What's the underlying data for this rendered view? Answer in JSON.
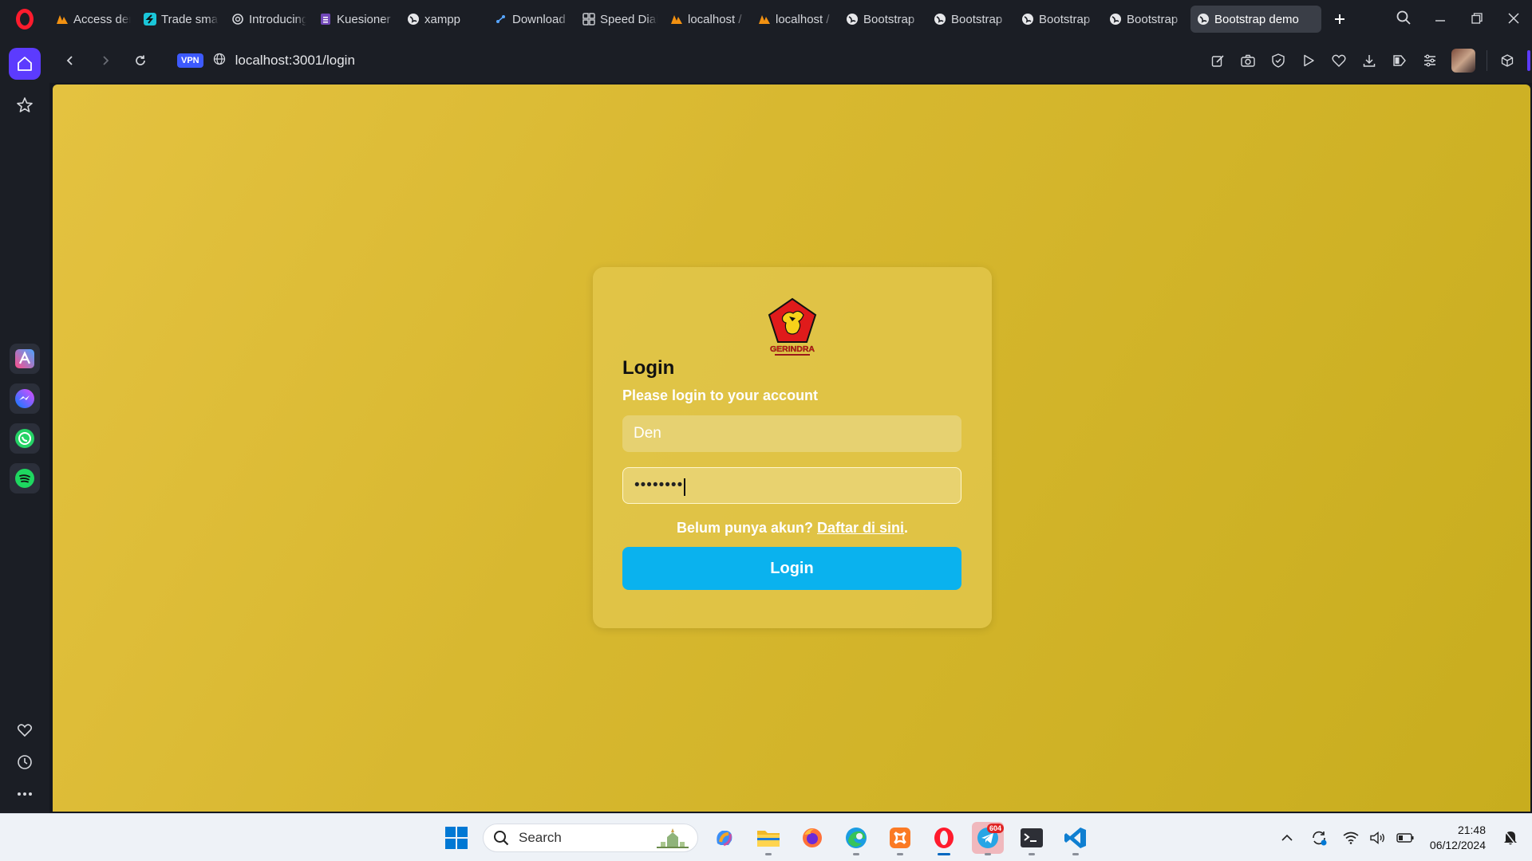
{
  "browser": {
    "tabs": [
      {
        "title": "Access den",
        "icon": "phpmyadmin-icon"
      },
      {
        "title": "Trade smar",
        "icon": "trading-icon"
      },
      {
        "title": "Introducing",
        "icon": "openai-icon"
      },
      {
        "title": "Kuesioner",
        "icon": "google-forms-icon"
      },
      {
        "title": "xampp",
        "icon": "globe-icon"
      },
      {
        "title": "Download",
        "icon": "download-site-icon"
      },
      {
        "title": "Speed Dial",
        "icon": "speed-dial-icon"
      },
      {
        "title": "localhost /",
        "icon": "phpmyadmin-icon"
      },
      {
        "title": "localhost /",
        "icon": "phpmyadmin-icon"
      },
      {
        "title": "Bootstrap",
        "icon": "globe-icon"
      },
      {
        "title": "Bootstrap",
        "icon": "globe-icon"
      },
      {
        "title": "Bootstrap",
        "icon": "globe-icon"
      },
      {
        "title": "Bootstrap",
        "icon": "globe-icon"
      },
      {
        "title": "Bootstrap demo",
        "icon": "globe-icon",
        "active": true
      }
    ],
    "address": {
      "vpn_label": "VPN",
      "url": "localhost:3001/login"
    }
  },
  "page": {
    "logo_text": "GERINDRA",
    "title": "Login",
    "subtitle": "Please login to your account",
    "username_value": "Den",
    "password_value": "••••••••",
    "signup_text": "Belum punya akun?",
    "signup_link": "Daftar di sini",
    "signup_period": ".",
    "login_button": "Login"
  },
  "taskbar": {
    "search_placeholder": "Search",
    "telegram_badge": "604",
    "time": "21:48",
    "date": "06/12/2024"
  },
  "colors": {
    "page_bg": "#d8b830",
    "card_bg": "#e2c54a",
    "login_button": "#0ab2ee",
    "browser_chrome": "#1b1e25",
    "opera_red": "#ff1b2d",
    "accent": "#5c3bfe"
  }
}
